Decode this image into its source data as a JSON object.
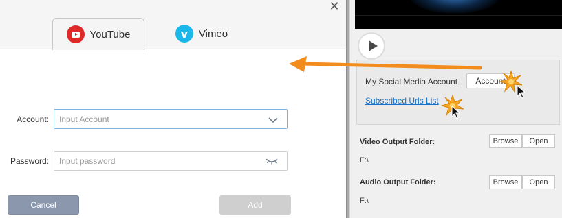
{
  "dialog": {
    "close_glyph": "✕",
    "tabs": [
      {
        "label": "YouTube",
        "icon": "youtube-icon",
        "active": true
      },
      {
        "label": "Vimeo",
        "icon": "vimeo-icon",
        "active": false
      }
    ],
    "account": {
      "label": "Account:",
      "placeholder": "Input Account"
    },
    "password": {
      "label": "Password:",
      "placeholder": "Input password"
    },
    "cancel_label": "Cancel",
    "add_label": "Add"
  },
  "panel": {
    "social_label": "My Social Media Account",
    "account_button": "Account",
    "subscribed_link": "Subscribed Urls List",
    "video_folder": {
      "title": "Video Output Folder:",
      "path": "F:\\",
      "browse": "Browse",
      "open": "Open"
    },
    "audio_folder": {
      "title": "Audio Output Folder:",
      "path": "F:\\",
      "browse": "Browse",
      "open": "Open"
    }
  },
  "colors": {
    "youtube_red": "#e02828",
    "vimeo_blue": "#1ab7ea",
    "arrow_orange": "#f28c1c",
    "link_blue": "#1a73c9",
    "cancel_button": "#8a97ad",
    "add_button_disabled": "#cfcfcf"
  }
}
